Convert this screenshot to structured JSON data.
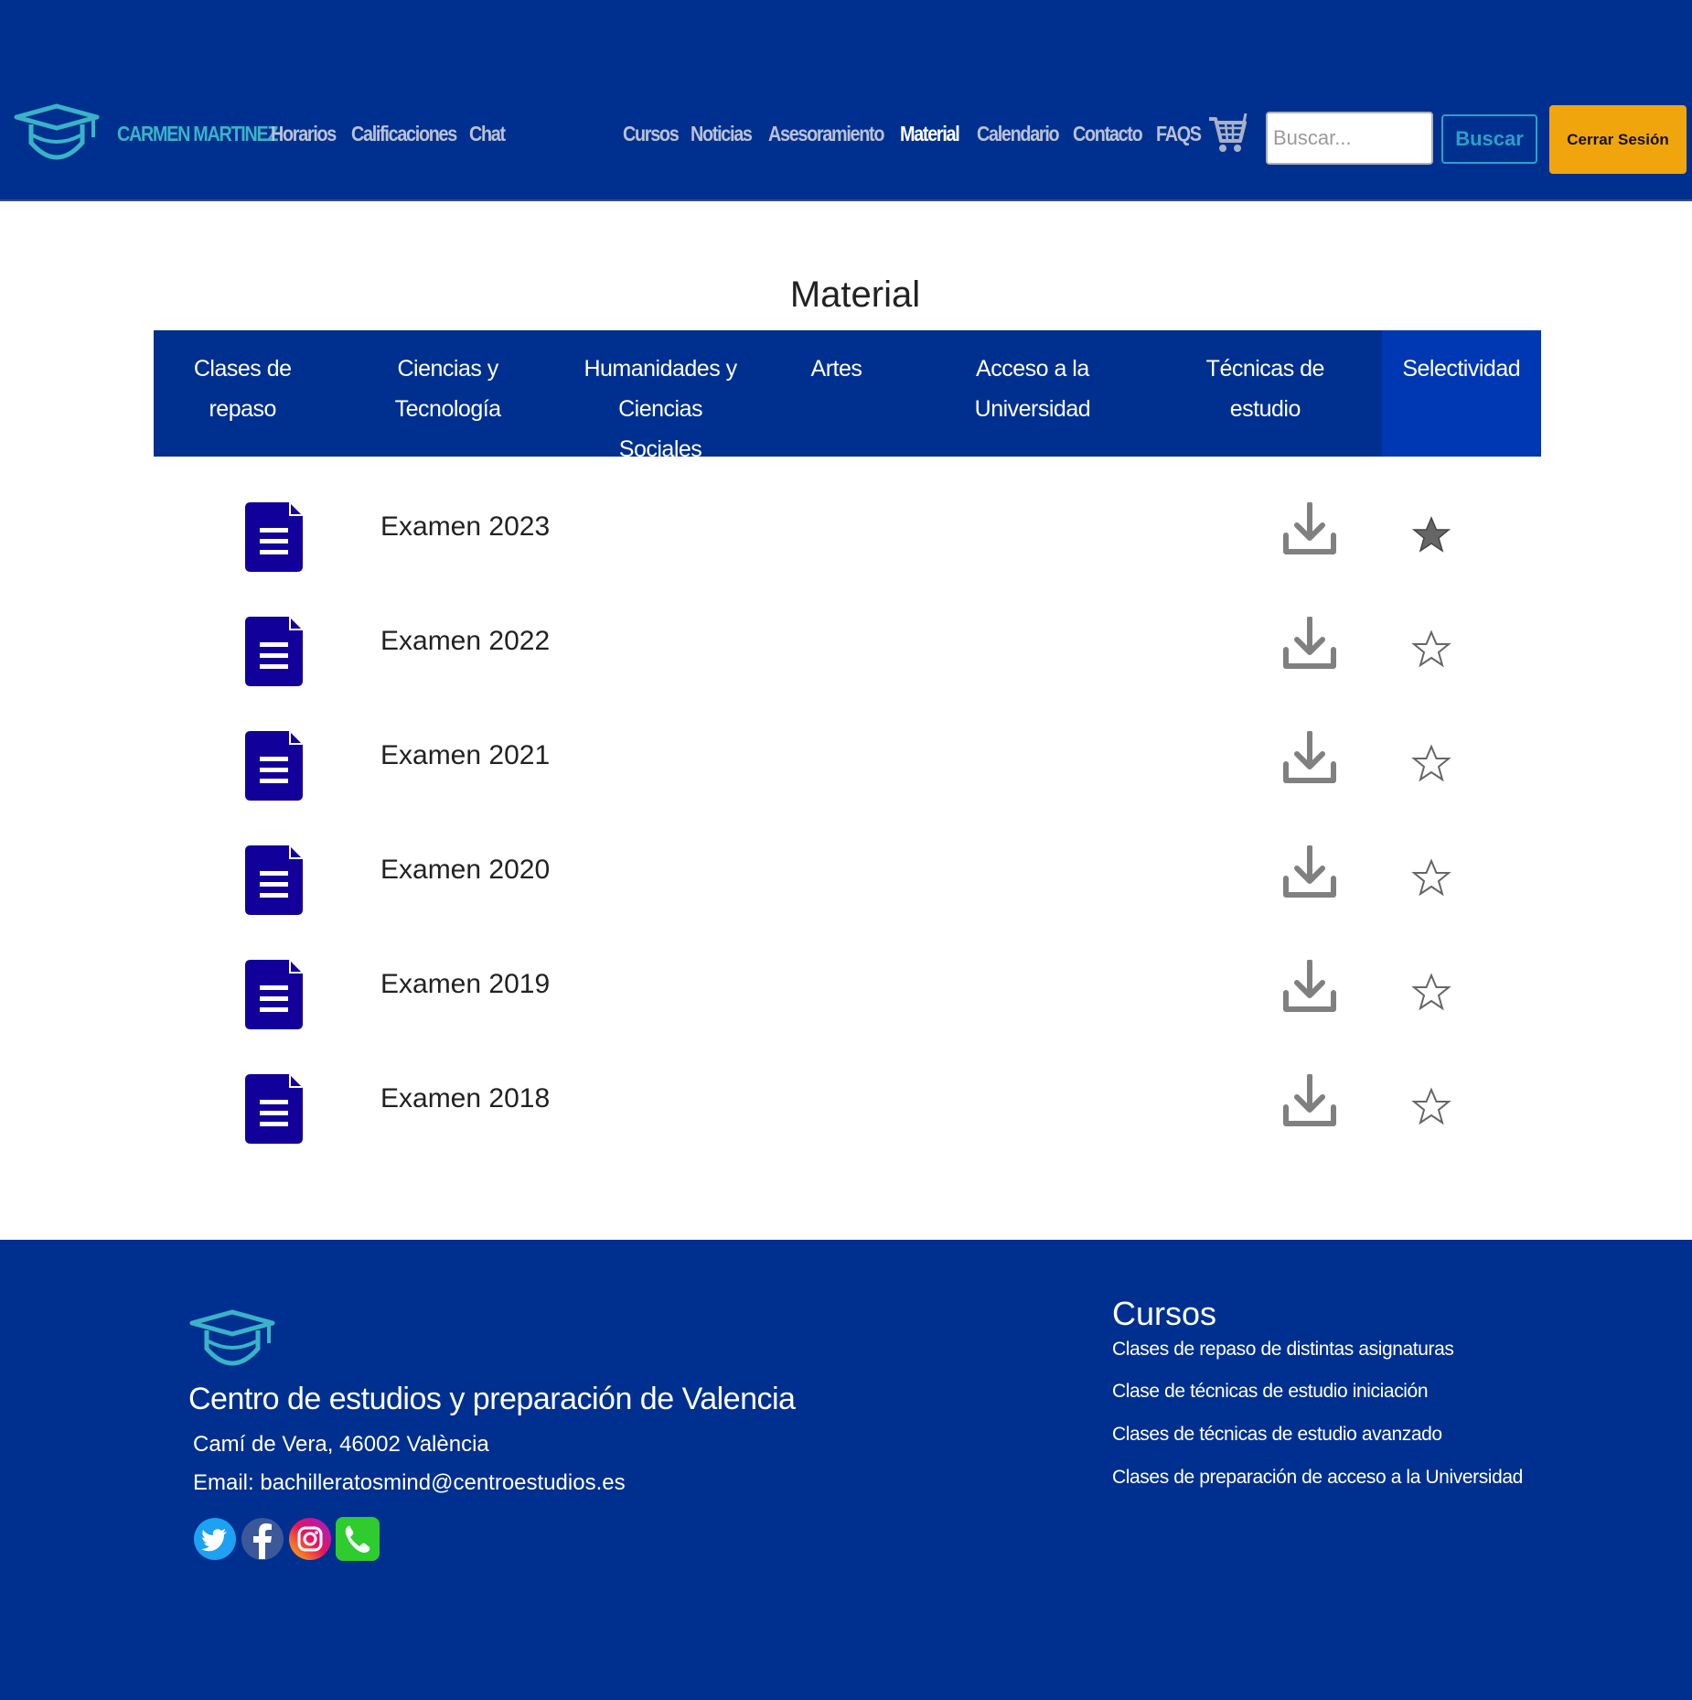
{
  "nav": {
    "user_name": "CARMEN MARTINEZ",
    "left_links": [
      "Horarios",
      "Calificaciones",
      "Chat"
    ],
    "right_links": [
      "Cursos",
      "Noticias",
      "Asesoramiento",
      "Material",
      "Calendario",
      "Contacto",
      "FAQS"
    ],
    "active_link": "Material",
    "search_placeholder": "Buscar...",
    "search_button": "Buscar",
    "logout_button": "Cerrar Sesión"
  },
  "main": {
    "title": "Material",
    "tabs": [
      {
        "label": "Clases de repaso",
        "active": false
      },
      {
        "label": "Ciencias y Tecnología",
        "active": false
      },
      {
        "label": "Humanidades y Ciencias Sociales",
        "active": false
      },
      {
        "label": "Artes",
        "active": false
      },
      {
        "label": "Acceso a la Universidad",
        "active": false
      },
      {
        "label": "Técnicas de estudio",
        "active": false
      },
      {
        "label": "Selectividad",
        "active": true
      }
    ],
    "files": [
      {
        "label": "Examen 2023",
        "favorite": true
      },
      {
        "label": "Examen 2022",
        "favorite": false
      },
      {
        "label": "Examen 2021",
        "favorite": false
      },
      {
        "label": "Examen 2020",
        "favorite": false
      },
      {
        "label": "Examen 2019",
        "favorite": false
      },
      {
        "label": "Examen 2018",
        "favorite": false
      }
    ]
  },
  "footer": {
    "title": "Centro de estudios y preparación de Valencia",
    "address": "Camí de Vera, 46002 València",
    "email": "Email: bachilleratosmind@centroestudios.es",
    "social_icons": [
      "twitter-icon",
      "facebook-icon",
      "instagram-icon",
      "phone-icon"
    ],
    "courses_heading": "Cursos",
    "courses_links": [
      "Clases de repaso de distintas asignaturas",
      "Clase de técnicas de estudio iniciación",
      "Clases de técnicas de estudio avanzado",
      "Clases de preparación de acceso a la Universidad"
    ]
  },
  "colors": {
    "nav_bg": "#00308f",
    "active_tab_bg": "#0038b4",
    "accent_orange": "#f1a50c",
    "accent_cyan": "#3ab3c9",
    "doc_icon": "#12009a",
    "icon_gray": "#808080"
  }
}
